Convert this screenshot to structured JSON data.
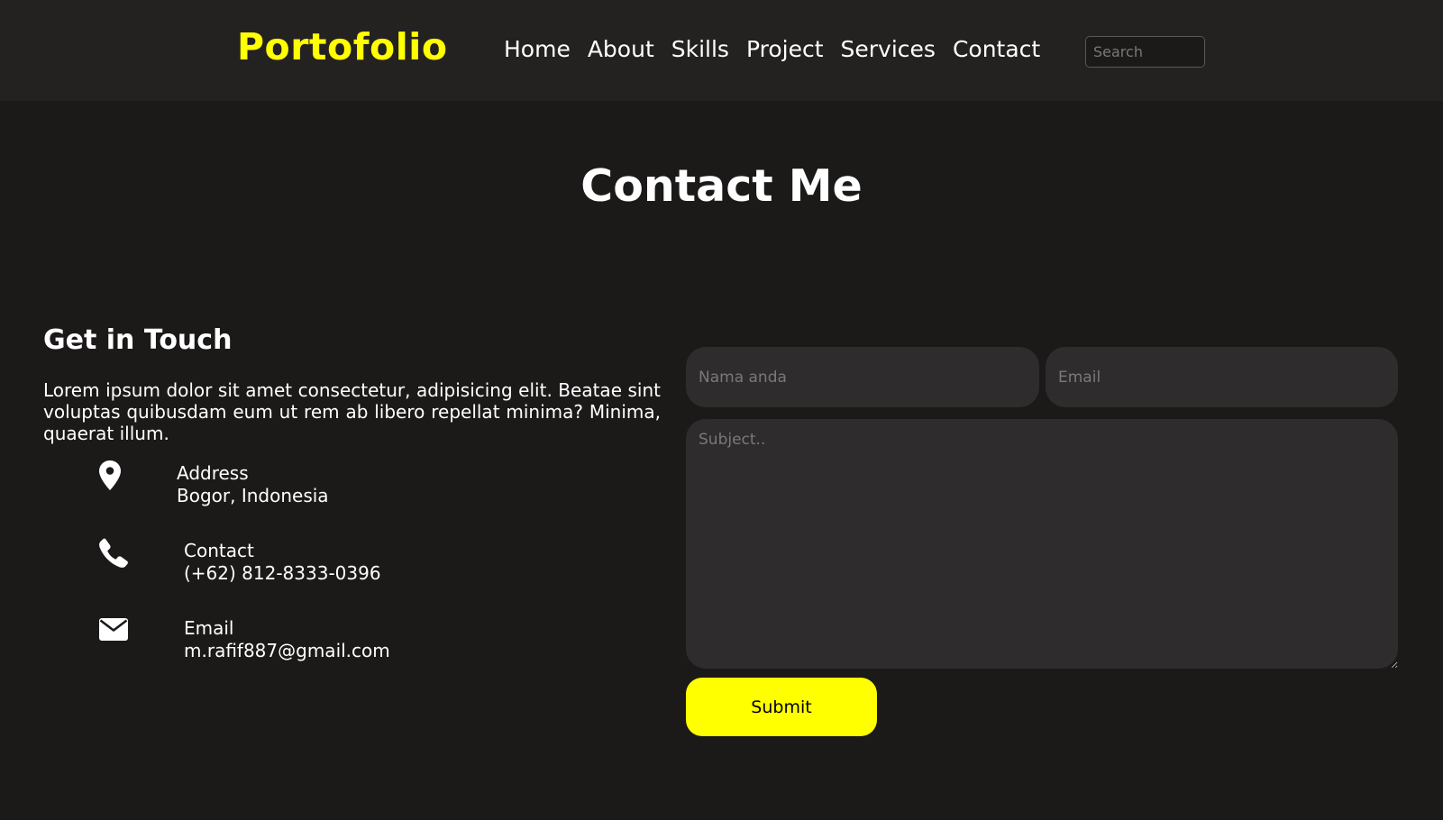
{
  "navbar": {
    "brand": "Portofolio",
    "links": [
      "Home",
      "About",
      "Skills",
      "Project",
      "Services",
      "Contact"
    ],
    "search_placeholder": "Search"
  },
  "page_title": "Contact Me",
  "get_in_touch": {
    "title": "Get in Touch",
    "description": "Lorem ipsum dolor sit amet consectetur, adipisicing elit. Beatae sint voluptas quibusdam eum ut rem ab libero repellat minima? Minima, quaerat illum."
  },
  "info": [
    {
      "icon": "map-pin-icon",
      "label": "Address",
      "value": "Bogor, Indonesia"
    },
    {
      "icon": "phone-icon",
      "label": "Contact",
      "value": "(+62) 812-8333-0396"
    },
    {
      "icon": "envelope-icon",
      "label": "Email",
      "value": "m.rafif887@gmail.com"
    }
  ],
  "form": {
    "name_placeholder": "Nama anda",
    "email_placeholder": "Email",
    "subject_placeholder": "Subject..",
    "submit_label": "Submit"
  },
  "colors": {
    "accent": "#ffff00",
    "background": "#1c1919",
    "navbar": "#242121",
    "field": "#2e2c2d"
  }
}
